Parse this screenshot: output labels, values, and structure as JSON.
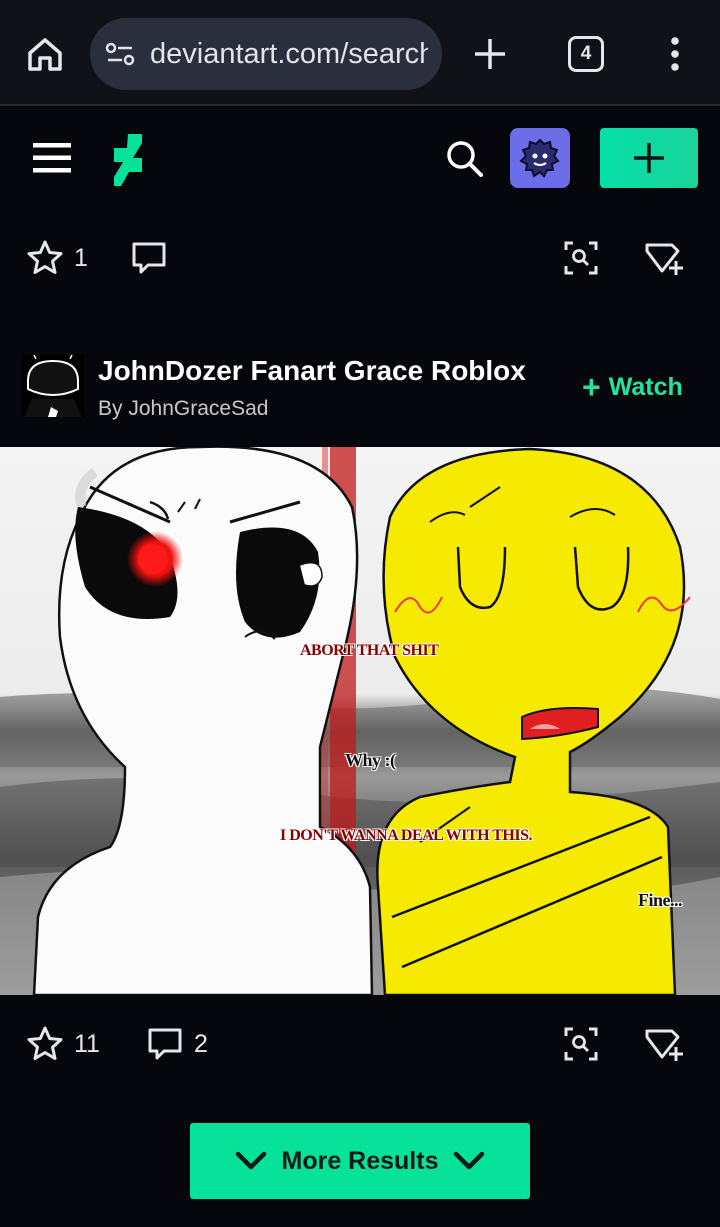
{
  "browser": {
    "url": "deviantart.com/search",
    "tab_count": "4",
    "icons": [
      "home-icon",
      "site-settings-icon",
      "new-tab-icon",
      "tab-switcher-icon",
      "more-menu-icon"
    ]
  },
  "header": {
    "icons": [
      "hamburger-icon",
      "deviantart-logo",
      "search-icon",
      "avatar-icon",
      "plus-icon"
    ],
    "accent_color": "#05e0a8"
  },
  "top_actions": {
    "favourites": "1",
    "comments": ""
  },
  "deviation": {
    "title": "JohnDozer Fanart Grace Roblox",
    "byline": "By JohnGraceSad",
    "watch_label": "Watch",
    "captions": {
      "c1": "ABORT THAT SHIT",
      "c2": "Why :(",
      "c3": "I DON'T WANNA DEAL WITH THIS.",
      "c4": "Fine..."
    }
  },
  "bottom_actions": {
    "favourites": "11",
    "comments": "2"
  },
  "more_results": {
    "label": "More Results"
  }
}
